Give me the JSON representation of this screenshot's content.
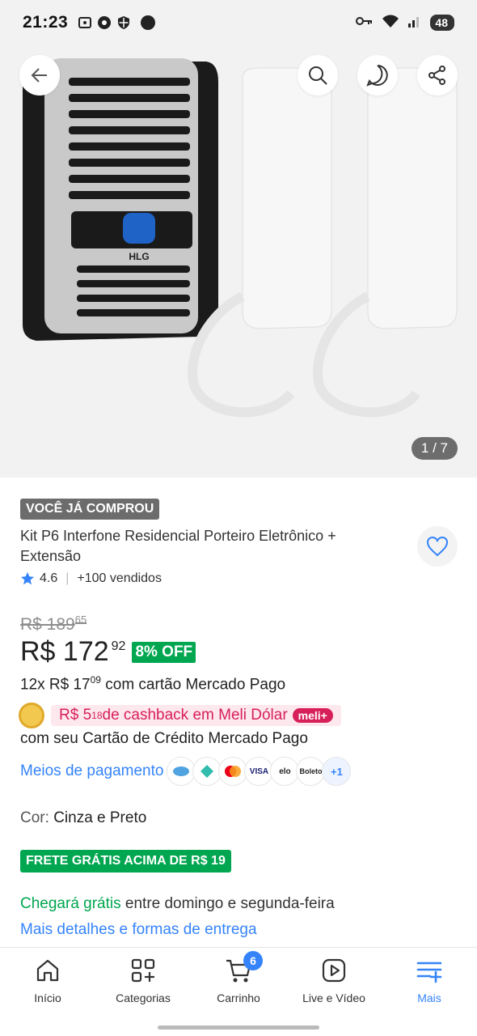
{
  "status_bar": {
    "time": "21:23",
    "battery": "48"
  },
  "gallery": {
    "counter": "1 / 7",
    "brand_mark": "HLG"
  },
  "product": {
    "purchased_badge": "VOCÊ JÁ COMPROU",
    "title": "Kit P6 Interfone Residencial Porteiro Eletrônico + Extensão",
    "rating": "4.6",
    "sold": "+100 vendidos",
    "old_price_int": "R$ 189",
    "old_price_cents": "65",
    "price_int": "R$ 172",
    "price_cents": "92",
    "discount": "8% OFF",
    "installments_prefix": "12x R$ 17",
    "installments_cents": "09",
    "installments_suffix": " com cartão Mercado Pago",
    "cashback_prefix": "R$ 5",
    "cashback_cents": "18",
    "cashback_suffix": " de cashback em Meli Dólar",
    "meli_tag": "meli+",
    "card_text": "com seu Cartão de Crédito Mercado Pago",
    "payment_link": "Meios de pagamento",
    "payment_methods": [
      "VISA",
      "elo",
      "Boleto"
    ],
    "payment_more": "+1",
    "color_label": "Cor: ",
    "color_value": "Cinza e Preto",
    "free_shipping_badge": "FRETE GRÁTIS ACIMA DE R$ 19",
    "delivery_green": "Chegará grátis",
    "delivery_rest": " entre domingo e segunda-feira",
    "delivery_link": "Mais detalhes e formas de entrega"
  },
  "nav": {
    "items": [
      {
        "label": "Início",
        "icon": "home-icon"
      },
      {
        "label": "Categorias",
        "icon": "categories-icon"
      },
      {
        "label": "Carrinho",
        "icon": "cart-icon"
      },
      {
        "label": "Live e Vídeo",
        "icon": "play-icon"
      },
      {
        "label": "Mais",
        "icon": "menu-plus-icon"
      }
    ],
    "cart_count": "6"
  },
  "colors": {
    "accent": "#3483fa",
    "green": "#00a650",
    "pink": "#d7205a"
  }
}
